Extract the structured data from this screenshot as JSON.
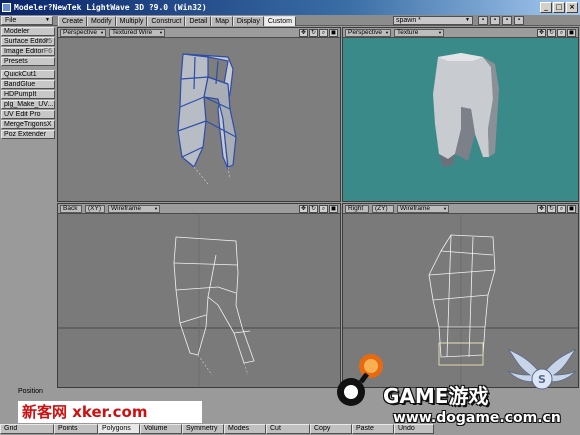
{
  "window": {
    "title": "Modeler?NewTek LightWave 3D ?9.0 (Win32)",
    "buttons": [
      "_",
      "□",
      "×"
    ]
  },
  "toolbar": {
    "file_label": "File",
    "tabs": [
      "Create",
      "Modify",
      "Multiply",
      "Construct",
      "Detail",
      "Map",
      "Display",
      "Custom"
    ],
    "active_tab": "Custom",
    "spawn_value": "spawn *"
  },
  "sidebar": {
    "items": [
      {
        "label": "Modeler",
        "key": ""
      },
      {
        "label": "Surface Editor",
        "key": "F5"
      },
      {
        "label": "Image Editor",
        "key": "F6"
      },
      {
        "label": "Presets",
        "key": ""
      },
      {
        "label": "QuickCut1",
        "key": ""
      },
      {
        "label": "BandGlue",
        "key": ""
      },
      {
        "label": "HDPumpIt",
        "key": ""
      },
      {
        "label": "plg_Make_UV...",
        "key": ""
      },
      {
        "label": "UV Edit Pro",
        "key": ""
      },
      {
        "label": "MergeTrigonsX",
        "key": ""
      },
      {
        "label": "Poz Extender",
        "key": ""
      }
    ]
  },
  "viewports": {
    "top_left": {
      "view": "Perspective",
      "mode": "Textured Wire"
    },
    "top_right": {
      "view": "Perspective",
      "mode": "Texture"
    },
    "bottom_left": {
      "view": "Back",
      "axes": "(XY)",
      "mode": "Wireframe"
    },
    "bottom_right": {
      "view": "Right",
      "axes": "(ZY)",
      "mode": "Wireframe"
    }
  },
  "status": {
    "position_label": "Position"
  },
  "bottom_bar": {
    "buttons": [
      "Grid",
      "Points",
      "Polygons",
      "Volume",
      "Symmetry",
      "Modes",
      "Cut",
      "Copy",
      "Paste",
      "Undo"
    ],
    "active": "Polygons"
  },
  "watermarks": {
    "xker_cn": "新客网",
    "xker_en": "xker.com",
    "game_text": "GAME游戏",
    "game_url": "www.dogame.com.cn"
  },
  "colors": {
    "teal_background": "#3a8a8a",
    "wire_blue": "#2d4ea8",
    "model_gray": "#b8bcc4"
  }
}
